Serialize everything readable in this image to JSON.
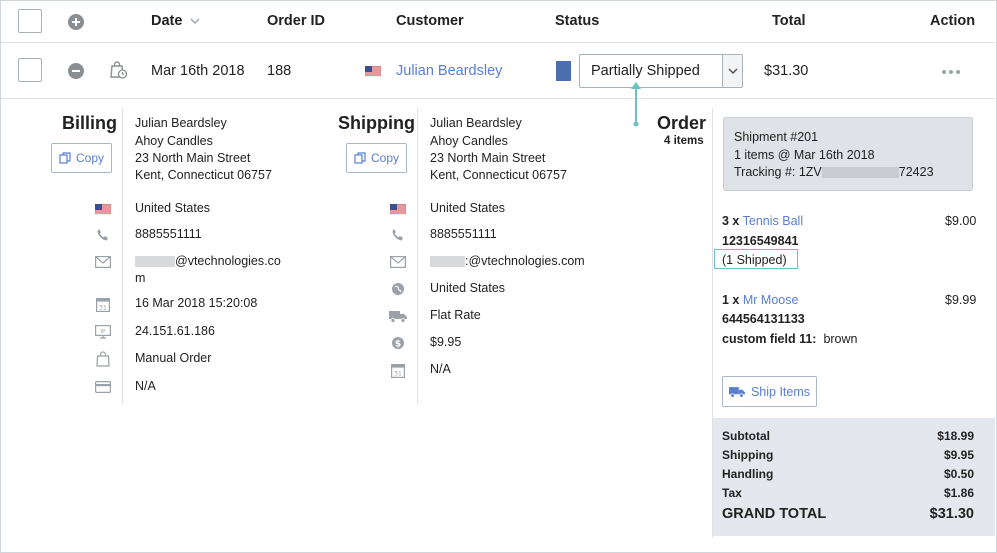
{
  "header": {
    "date": "Date",
    "order_id": "Order ID",
    "customer": "Customer",
    "status": "Status",
    "total": "Total",
    "action": "Action"
  },
  "order": {
    "date": "Mar 16th 2018",
    "id": "188",
    "customer": "Julian Beardsley",
    "status": "Partially Shipped",
    "total": "$31.30",
    "status_color": "#4b6fae"
  },
  "billing": {
    "title": "Billing",
    "copy_label": "Copy",
    "name": "Julian Beardsley",
    "company": "Ahoy Candles",
    "street": "23 North Main Street",
    "city": "Kent, Connecticut 06757",
    "country": "United States",
    "phone": "8885551111",
    "email_domain": "@vtechnologies.co",
    "email_wrap": "m",
    "date": "16 Mar 2018 15:20:08",
    "ip": "24.151.61.186",
    "source": "Manual Order",
    "payment": "N/A"
  },
  "shipping": {
    "title": "Shipping",
    "copy_label": "Copy",
    "name": "Julian Beardsley",
    "company": "Ahoy Candles",
    "street": "23 North Main Street",
    "city": "Kent, Connecticut 06757",
    "country": "United States",
    "phone": "8885551111",
    "email_domain": ":@vtechnologies.com",
    "country_link": "United States",
    "method": "Flat Rate",
    "cost": "$9.95",
    "date": "N/A"
  },
  "order_panel": {
    "title": "Order",
    "items_count": "4 items",
    "shipment": {
      "link": "Shipment #201",
      "info": "1 items @ Mar 16th 2018",
      "tracking_prefix": "Tracking #: 1ZV",
      "tracking_suffix": "72423"
    },
    "items": [
      {
        "qty": "3 x",
        "name": "Tennis Ball",
        "price": "$9.00",
        "sku": "12316549841",
        "note": "(1 Shipped)"
      },
      {
        "qty": "1 x",
        "name": "Mr Moose",
        "price": "$9.99",
        "sku": "644564131133",
        "custom_label": "custom field 11:",
        "custom_value": "brown"
      }
    ],
    "ship_items_label": "Ship Items",
    "totals": {
      "subtotal_label": "Subtotal",
      "subtotal": "$18.99",
      "shipping_label": "Shipping",
      "shipping": "$9.95",
      "handling_label": "Handling",
      "handling": "$0.50",
      "tax_label": "Tax",
      "tax": "$1.86",
      "grand_label": "GRAND TOTAL",
      "grand": "$31.30"
    }
  }
}
